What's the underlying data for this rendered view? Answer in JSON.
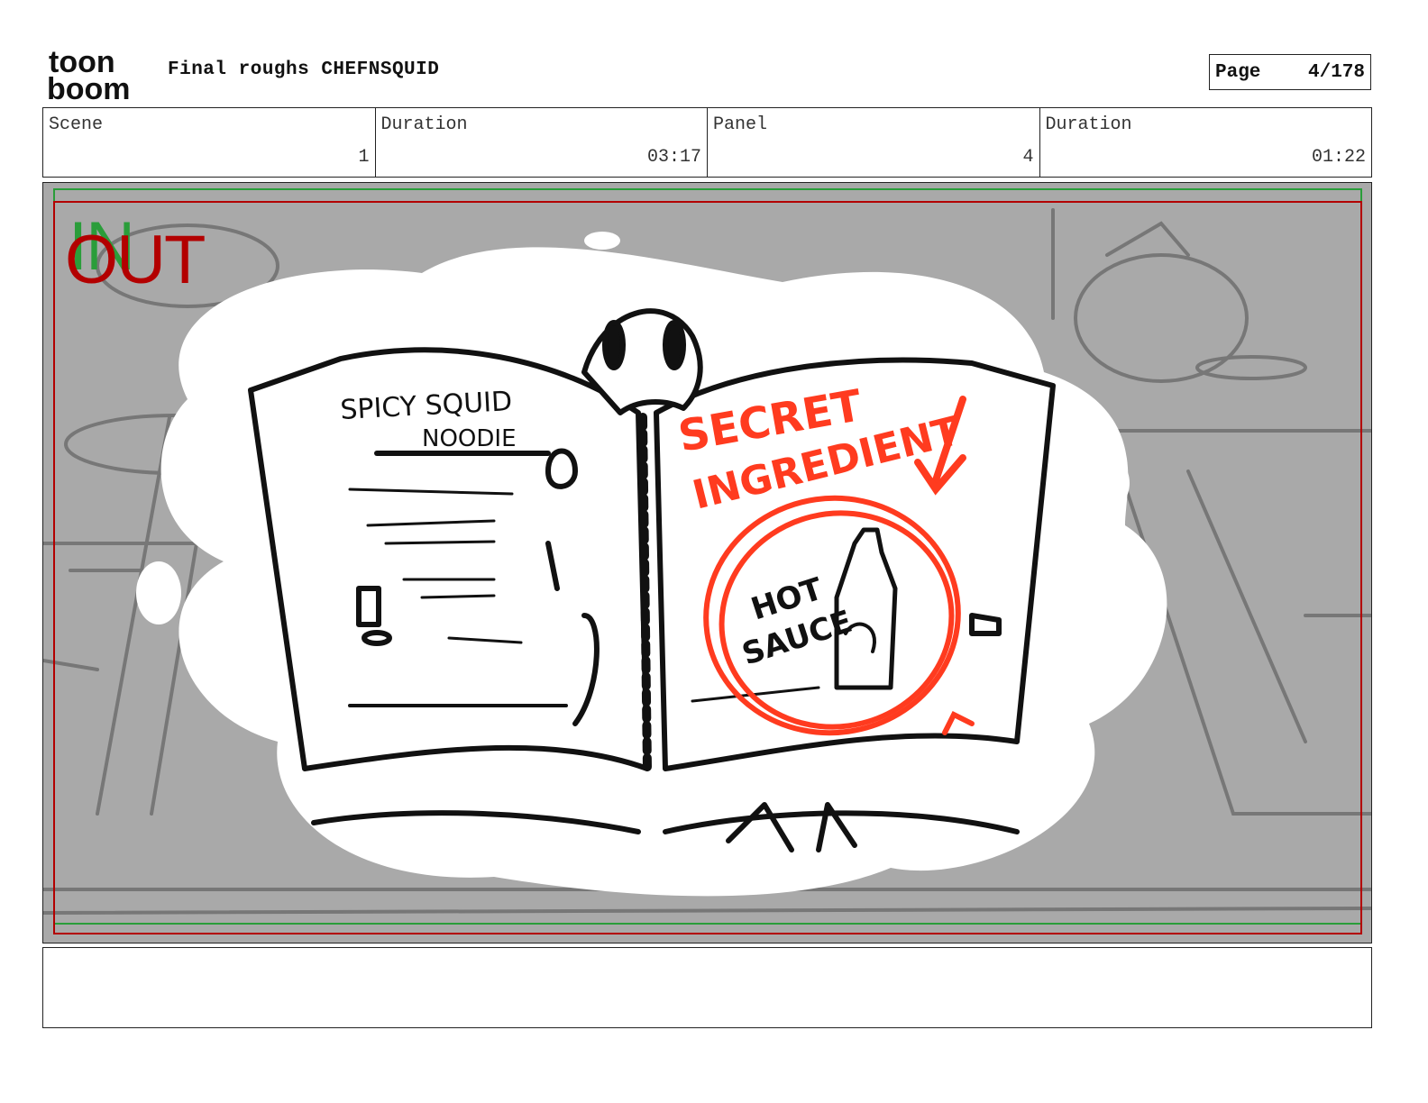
{
  "header": {
    "logo_text_top": "toon",
    "logo_text_bottom": "boom",
    "title": "Final roughs CHEFNSQUID",
    "page_label": "Page",
    "page_value": "4/178"
  },
  "info": {
    "scene_label": "Scene",
    "scene_value": "1",
    "scene_duration_label": "Duration",
    "scene_duration_value": "03:17",
    "panel_label": "Panel",
    "panel_value": "4",
    "panel_duration_label": "Duration",
    "panel_duration_value": "01:22"
  },
  "panel": {
    "in_marker": "IN",
    "out_marker": "OUT",
    "book_left_title_line1": "SPICY SQUID",
    "book_left_title_line2": "NOODIE",
    "book_right_heading_line1": "SECRET",
    "book_right_heading_line2": "INGREDIENT",
    "circled_label_line1": "HOT",
    "circled_label_line2": "SAUCE",
    "colors": {
      "safe_frame_green": "#2a9d3a",
      "safe_frame_red": "#b30000",
      "annotation_red": "#ff3b1f",
      "background_gray": "#a9a9a9"
    }
  },
  "notes": {
    "text": ""
  }
}
